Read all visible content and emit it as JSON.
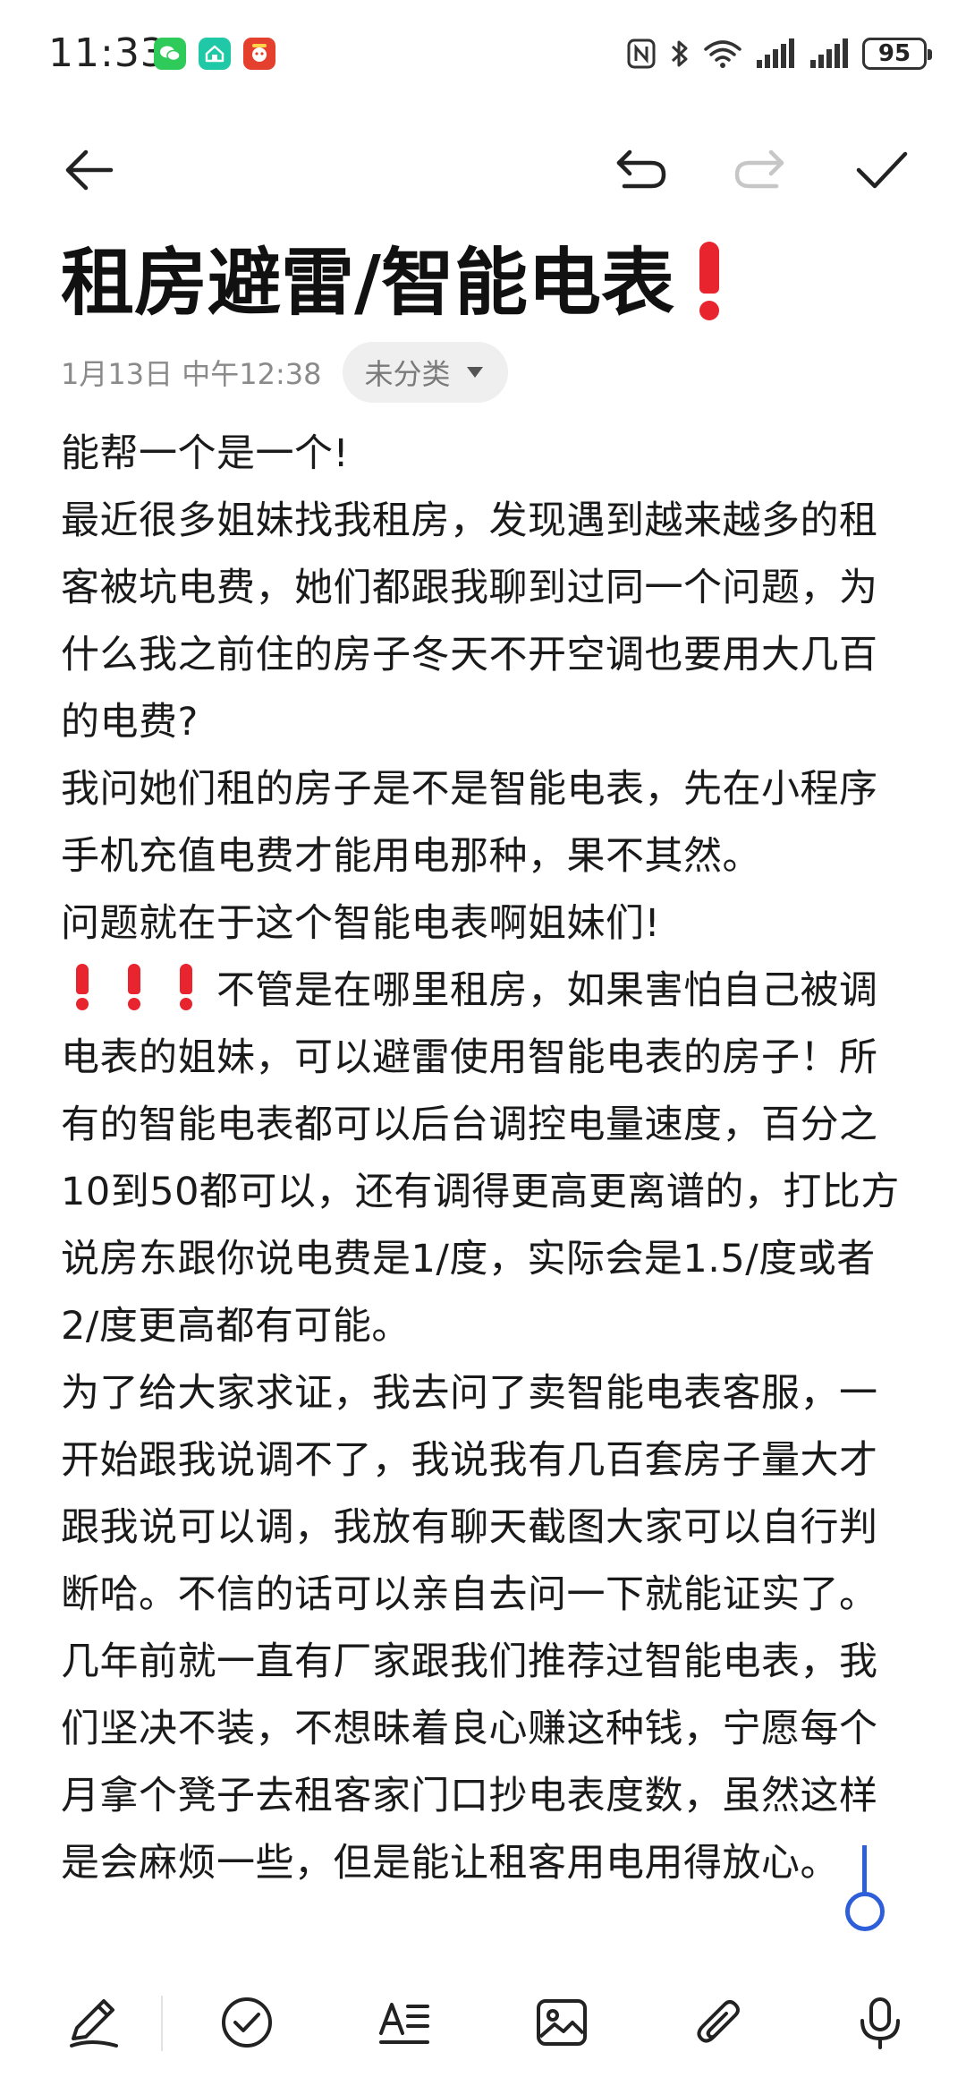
{
  "status_bar": {
    "time": "11:33",
    "battery": "95",
    "icons": [
      "wechat-icon",
      "home-app-icon",
      "red-app-icon",
      "nfc-icon",
      "bluetooth-icon",
      "wifi-icon",
      "signal-icon",
      "signal-icon-2",
      "battery-icon"
    ]
  },
  "toolbar": {
    "icons": [
      "back-arrow-icon",
      "undo-icon",
      "redo-icon",
      "check-icon"
    ],
    "redo_disabled": true
  },
  "note": {
    "title": "租房避雷/智能电表",
    "date": "1月13日 中午12:38",
    "category": "未分类",
    "paragraphs": [
      "能帮一个是一个!",
      "最近很多姐妹找我租房，发现遇到越来越多的租客被坑电费，她们都跟我聊到过同一个问题，为什么我之前住的房子冬天不开空调也要用大几百的电费?",
      "我问她们租的房子是不是智能电表，先在小程序手机充值电费才能用电那种，果不其然。",
      "问题就在于这个智能电表啊姐妹们!",
      "不管是在哪里租房，如果害怕自己被调电表的姐妹，可以避雷使用智能电表的房子！所有的智能电表都可以后台调控电量速度，百分之10到50都可以，还有调得更高更离谱的，打比方说房东跟你说电费是1/度，实际会是1.5/度或者2/度更高都有可能。",
      "为了给大家求证，我去问了卖智能电表客服，一开始跟我说调不了，我说我有几百套房子量大才跟我说可以调，我放有聊天截图大家可以自行判断哈。不信的话可以亲自去问一下就能证实了。",
      "几年前就一直有厂家跟我们推荐过智能电表，我们坚决不装，不想昧着良心赚这种钱，宁愿每个月拿个凳子去租客家门口抄电表度数，虽然这样是会麻烦一些，但是能让租客用电用得放心。"
    ]
  },
  "bottom_bar": {
    "icons": [
      "pen-icon",
      "checklist-icon",
      "text-format-icon",
      "image-icon",
      "attachment-icon",
      "microphone-icon"
    ]
  },
  "colors": {
    "accent": "#e8242e",
    "cursor": "#2f5fd8",
    "text": "#1a1a1a",
    "meta": "#8a8a8a"
  }
}
